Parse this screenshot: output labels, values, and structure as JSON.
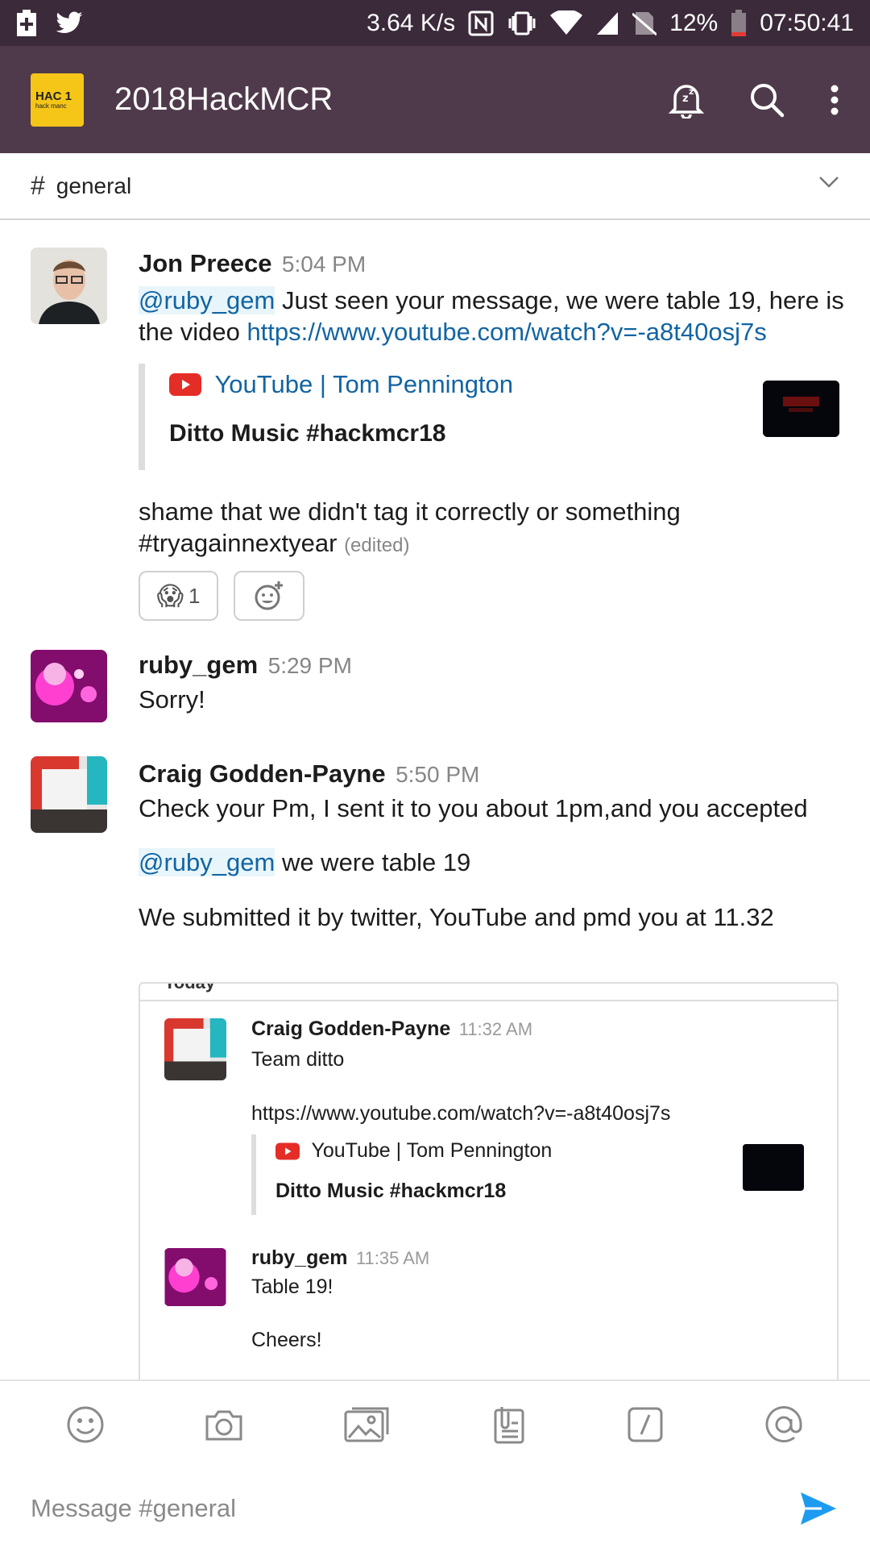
{
  "status_bar": {
    "net_speed": "3.64 K/s",
    "battery": "12%",
    "time": "07:50:41"
  },
  "app_bar": {
    "team_logo_line1": "HAC 1",
    "team_logo_line2": "hack manc",
    "team_name": "2018HackMCR",
    "icons": [
      "snooze-bell-icon",
      "search-icon",
      "more-vert-icon"
    ]
  },
  "channel": {
    "hash": "#",
    "name": "general"
  },
  "messages": [
    {
      "author": "Jon Preece",
      "time": "5:04 PM",
      "mention": "@ruby_gem",
      "text1": " Just seen your message, we were table 19, here is the video ",
      "link": "https://www.youtube.com/watch?v=-a8t40osj7s",
      "attachment": {
        "service": "YouTube | Tom Pennington",
        "title": "Ditto Music #hackmcr18"
      },
      "text2a": "shame that we didn't tag it correctly or something",
      "text2b": "#tryagainnextyear",
      "edited": "(edited)",
      "reaction": {
        "emoji": "😱",
        "count": "1"
      }
    },
    {
      "author": "ruby_gem",
      "time": "5:29 PM",
      "text": "Sorry!"
    },
    {
      "author": "Craig Godden-Payne",
      "time": "5:50 PM",
      "text1": "Check your Pm, I sent it to you about 1pm,and you accepted",
      "mention": "@ruby_gem",
      "text2": " we were table 19",
      "text3": "We submitted it by twitter, YouTube and pmd you at 11.32",
      "shared": {
        "today": "Today",
        "items": [
          {
            "author": "Craig Godden-Payne",
            "time": "11:32 AM",
            "text": "Team ditto",
            "link": "https://www.youtube.com/watch?v=-a8t40osj7s",
            "service": "YouTube | Tom Pennington",
            "title": "Ditto Music #hackmcr18"
          },
          {
            "author": "ruby_gem",
            "time": "11:35 AM",
            "text": "Table 19!",
            "text2": "Cheers!"
          }
        ]
      }
    }
  ],
  "compose": {
    "placeholder": "Message #general",
    "toolbar_icons": [
      "emoji-icon",
      "camera-icon",
      "gallery-icon",
      "files-icon",
      "slash-command-icon",
      "mention-icon"
    ]
  },
  "colors": {
    "status_bar": "#3b2a3a",
    "app_bar": "#4f3a4b",
    "link": "#1264a3",
    "send": "#1d9bf0"
  }
}
